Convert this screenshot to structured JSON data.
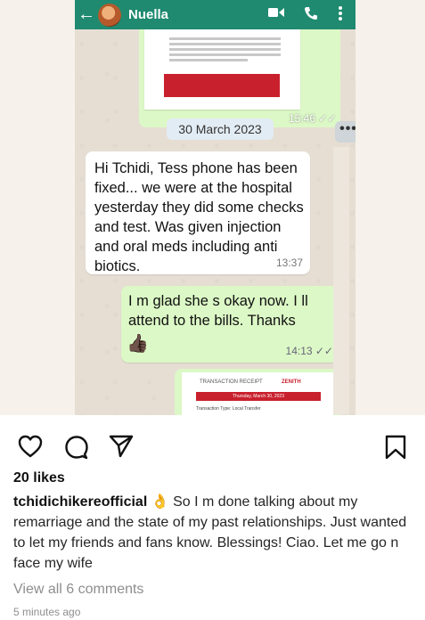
{
  "whatsapp": {
    "contact_name": "Nuella",
    "receipt_time": "15:46",
    "date_chip": "30 March 2023",
    "incoming_message": "Hi Tchidi, Tess phone has been fixed... we were at the hospital yesterday they did some checks and test. Was given injection and oral meds including anti biotics.",
    "incoming_time": "13:37",
    "outgoing_message": "I m glad she s okay now. I ll attend to the bills. Thanks",
    "outgoing_emoji": "👍🏿",
    "outgoing_time": "14:13",
    "receipt_title": "TRANSACTION RECEIPT",
    "receipt_brand": "ZENITH",
    "receipt_date": "Thursday, March 30, 2023",
    "receipt_type": "Transaction Type: Local Transfer"
  },
  "post": {
    "likes": "20 likes",
    "username": "tchidichikereofficial",
    "caption_emoji": "👌",
    "caption_text": "So I m done talking about my remarriage and the state of my past relationships. Just wanted to let my friends and fans know. Blessings! Ciao. Let me go n face my wife",
    "view_comments": "View all 6 comments",
    "timestamp": "5 minutes ago"
  },
  "icons": {
    "like": "heart-icon",
    "comment": "comment-icon",
    "share": "send-icon",
    "save": "bookmark-icon"
  },
  "colors": {
    "whatsapp_header": "#1f8a70",
    "outgoing_bubble": "#dcf8c6",
    "receipt_red": "#c9202d"
  }
}
